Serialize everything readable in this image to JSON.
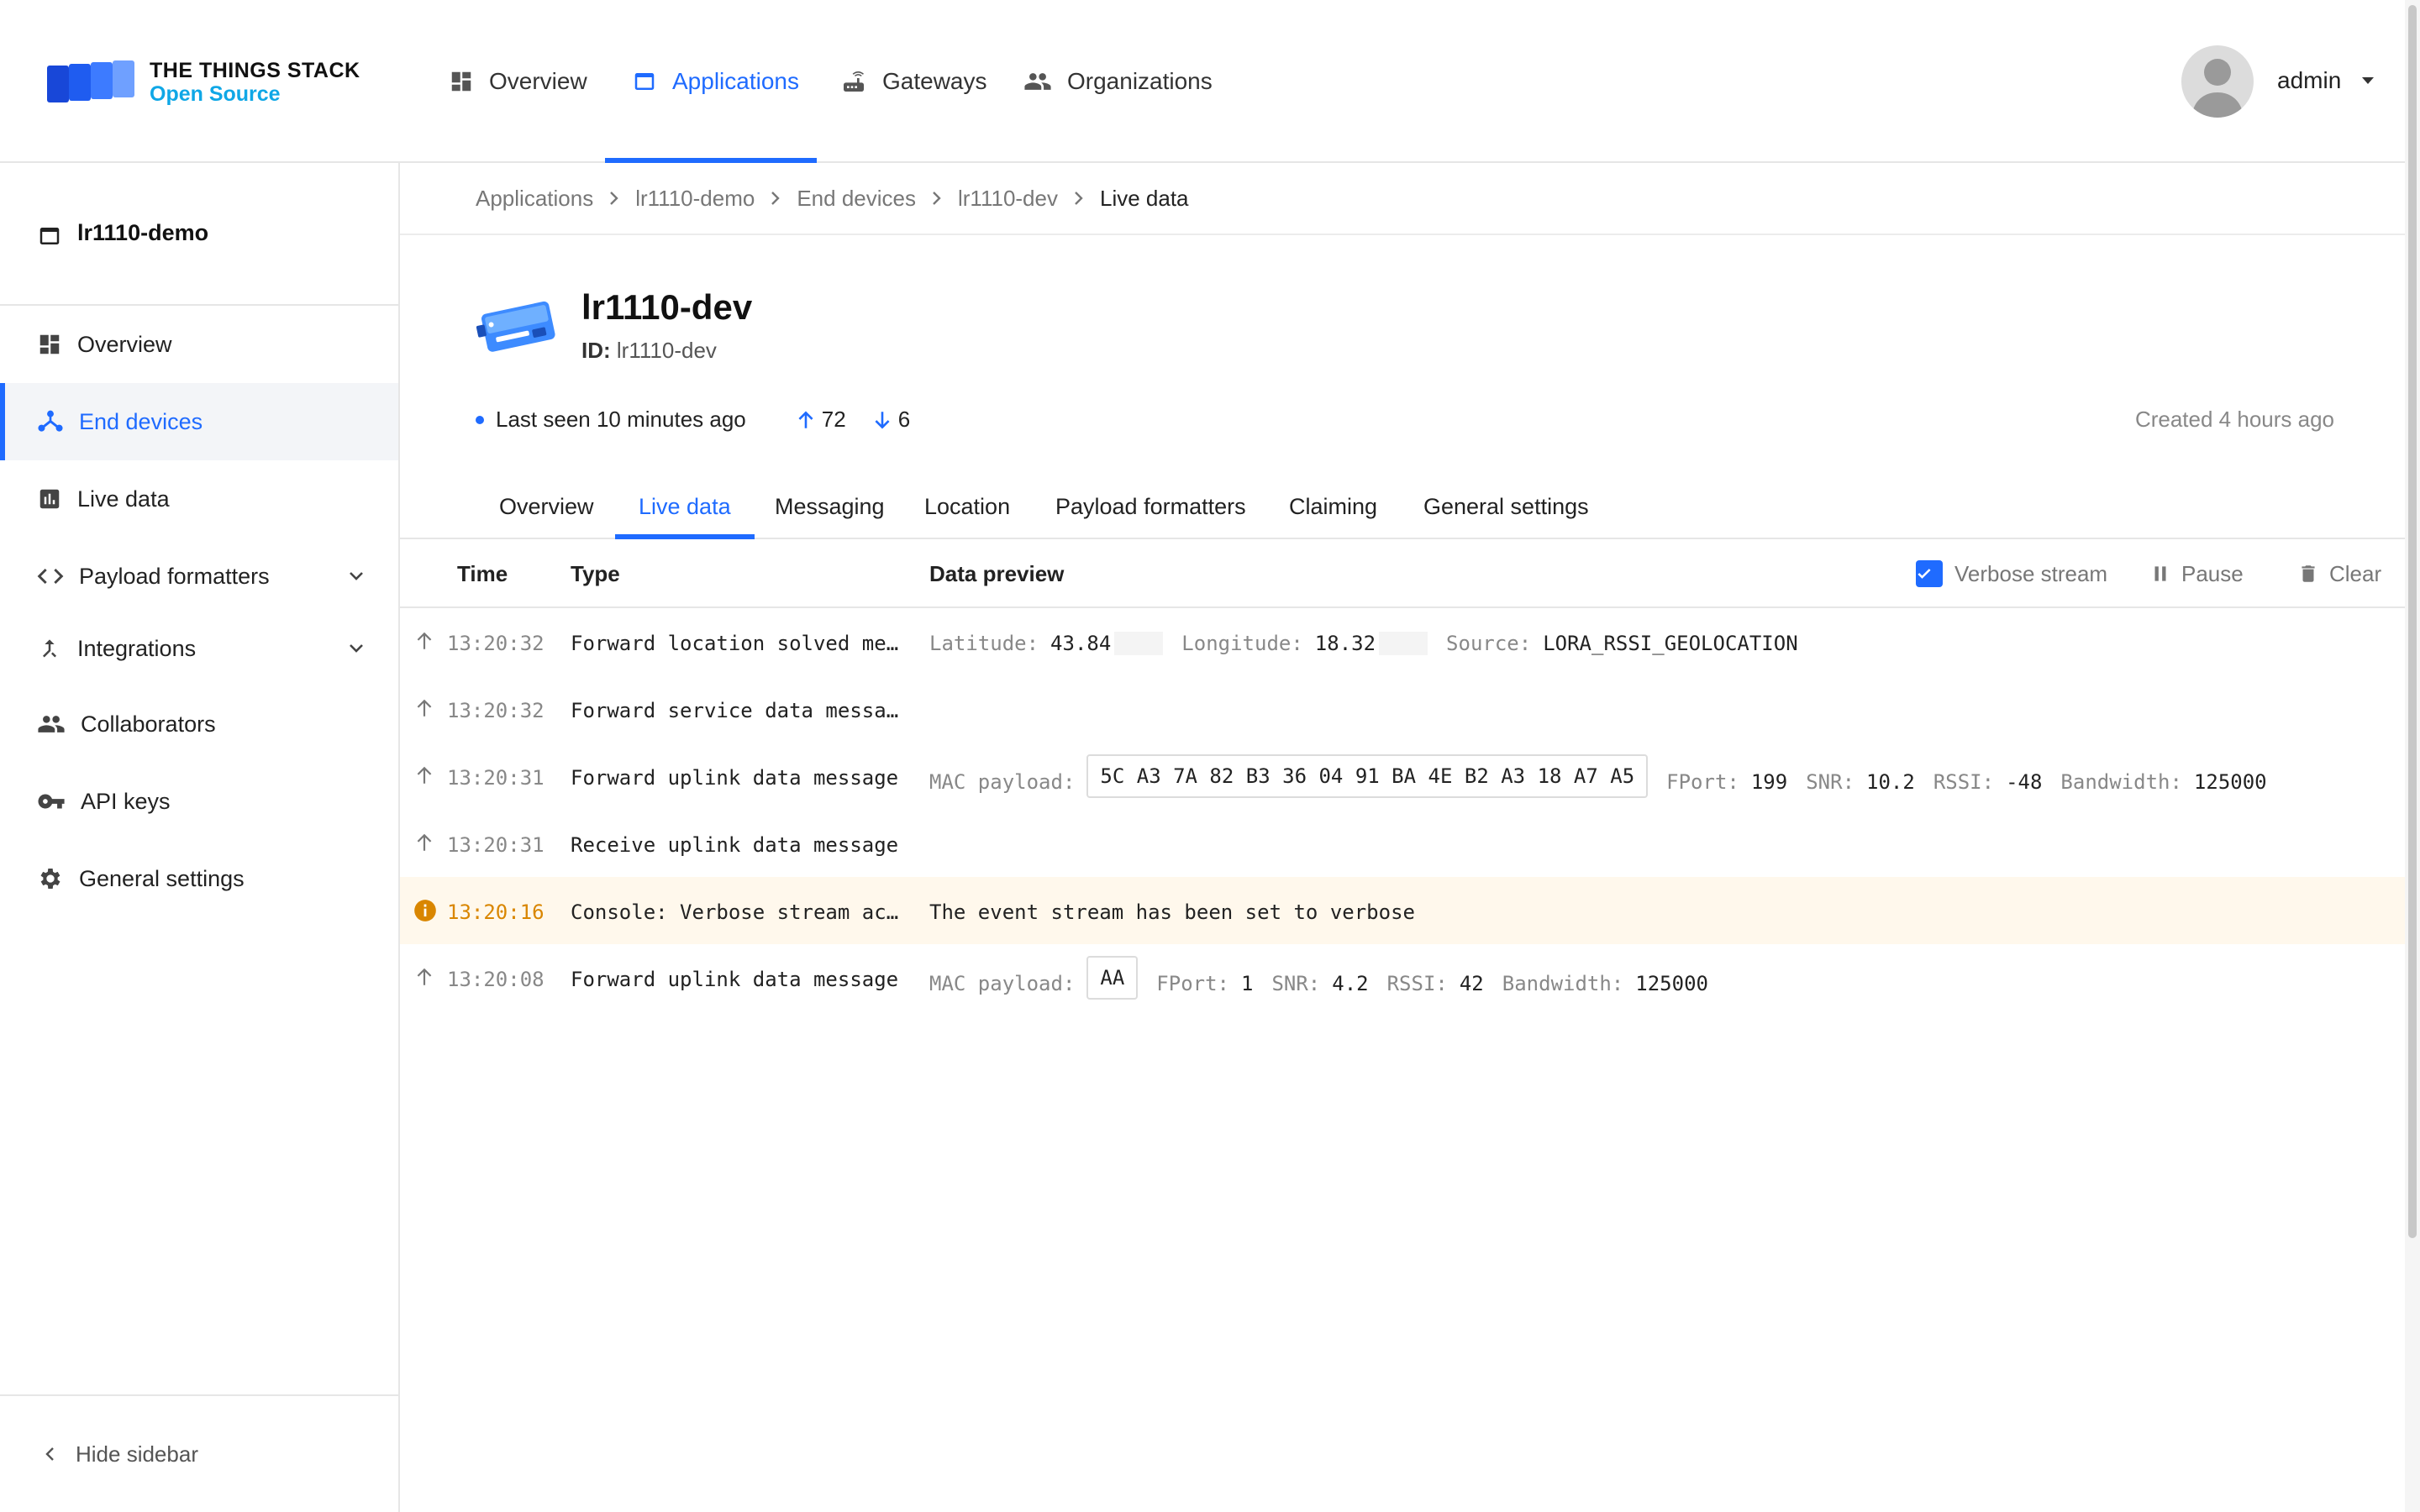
{
  "brand": {
    "title": "THE THINGS STACK",
    "subtitle": "Open Source"
  },
  "topnav": {
    "items": [
      {
        "label": "Overview",
        "icon": "dashboard-icon"
      },
      {
        "label": "Applications",
        "icon": "application-icon",
        "active": true
      },
      {
        "label": "Gateways",
        "icon": "router-icon"
      },
      {
        "label": "Organizations",
        "icon": "people-icon"
      }
    ],
    "user": "admin"
  },
  "sidebar": {
    "header": "lr1110-demo",
    "items": [
      {
        "label": "Overview",
        "icon": "dashboard-icon"
      },
      {
        "label": "End devices",
        "icon": "devices-icon",
        "active": true
      },
      {
        "label": "Live data",
        "icon": "chart-icon"
      },
      {
        "label": "Payload formatters",
        "icon": "code-icon",
        "expandable": true
      },
      {
        "label": "Integrations",
        "icon": "merge-icon",
        "expandable": true
      },
      {
        "label": "Collaborators",
        "icon": "people-icon"
      },
      {
        "label": "API keys",
        "icon": "key-icon"
      },
      {
        "label": "General settings",
        "icon": "gear-icon"
      }
    ],
    "footer": "Hide sidebar"
  },
  "breadcrumb": [
    "Applications",
    "lr1110-demo",
    "End devices",
    "lr1110-dev",
    "Live data"
  ],
  "device": {
    "name": "lr1110-dev",
    "id_label": "ID:",
    "id": "lr1110-dev",
    "last_seen": "Last seen 10 minutes ago",
    "uplinks": "72",
    "downlinks": "6",
    "created": "Created 4 hours ago"
  },
  "tabs": [
    "Overview",
    "Live data",
    "Messaging",
    "Location",
    "Payload formatters",
    "Claiming",
    "General settings"
  ],
  "active_tab": "Live data",
  "events_table": {
    "headers": {
      "time": "Time",
      "type": "Type",
      "preview": "Data preview"
    },
    "verbose_label": "Verbose stream",
    "verbose_checked": true,
    "pause_label": "Pause",
    "clear_label": "Clear"
  },
  "events": [
    {
      "time": "13:20:32",
      "type": "Forward location solved mes…",
      "kind": "uplink",
      "lat_label": "Latitude:",
      "lat": "43.84",
      "lon_label": "Longitude:",
      "lon": "18.32",
      "src_label": "Source:",
      "src": "LORA_RSSI_GEOLOCATION"
    },
    {
      "time": "13:20:32",
      "type": "Forward service data message",
      "kind": "uplink"
    },
    {
      "time": "13:20:31",
      "type": "Forward uplink data message",
      "kind": "uplink",
      "mac_label": "MAC payload:",
      "mac": "5C A3 7A 82 B3 36 04 91 BA 4E B2 A3 18 A7 A5",
      "fport_label": "FPort:",
      "fport": "199",
      "snr_label": "SNR:",
      "snr": "10.2",
      "rssi_label": "RSSI:",
      "rssi": "-48",
      "bw_label": "Bandwidth:",
      "bw": "125000"
    },
    {
      "time": "13:20:31",
      "type": "Receive uplink data message",
      "kind": "uplink"
    },
    {
      "time": "13:20:16",
      "type": "Console: Verbose stream act…",
      "kind": "info",
      "message": "The event stream has been set to verbose"
    },
    {
      "time": "13:20:08",
      "type": "Forward uplink data message",
      "kind": "uplink",
      "mac_label": "MAC payload:",
      "mac": "AA",
      "fport_label": "FPort:",
      "fport": "1",
      "snr_label": "SNR:",
      "snr": "4.2",
      "rssi_label": "RSSI:",
      "rssi": "42",
      "bw_label": "Bandwidth:",
      "bw": "125000"
    }
  ],
  "colors": {
    "accent": "#1f6bff",
    "brand_sub": "#0fa7e6",
    "warning": "#d98600"
  }
}
